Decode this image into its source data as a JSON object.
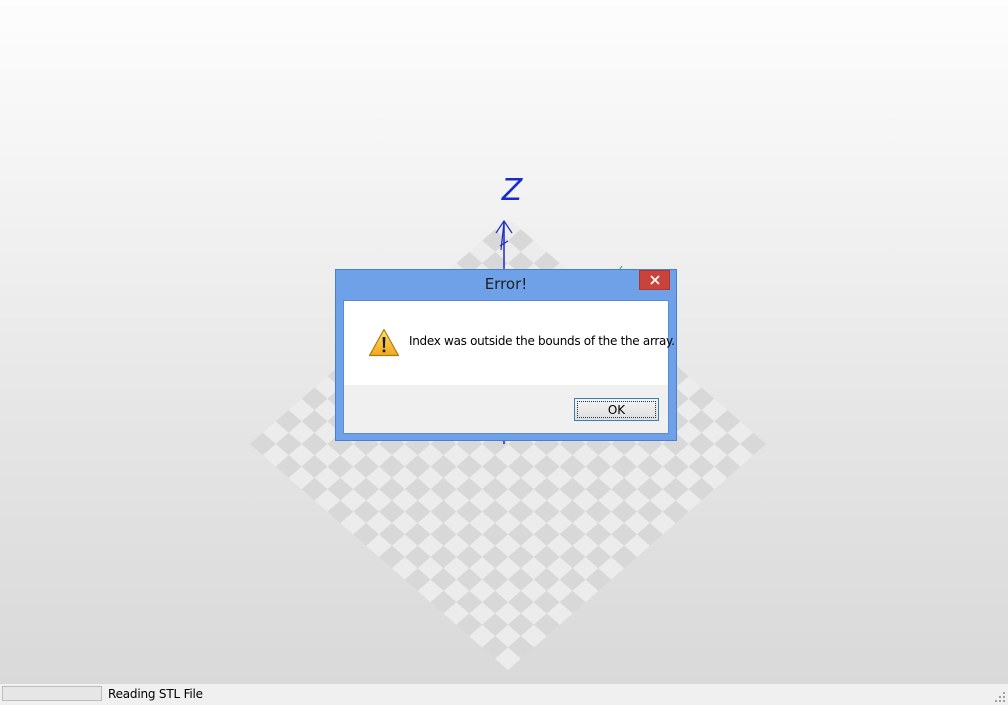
{
  "viewport": {
    "axis_label": "Z",
    "axis_color": "#1a2cc4",
    "y_axis_color": "#2da84a",
    "checker_light": "#ececec",
    "checker_dark": "#d8d8d8"
  },
  "dialog": {
    "title": "Error!",
    "message": "Index was outside the bounds of the the array.",
    "ok_label": "OK",
    "close_icon": "close-icon",
    "warning_icon": "warning-icon",
    "titlebar_color": "#6ea1e8",
    "close_color": "#c9433d"
  },
  "statusbar": {
    "progress": 0,
    "status_text": "Reading STL File"
  }
}
